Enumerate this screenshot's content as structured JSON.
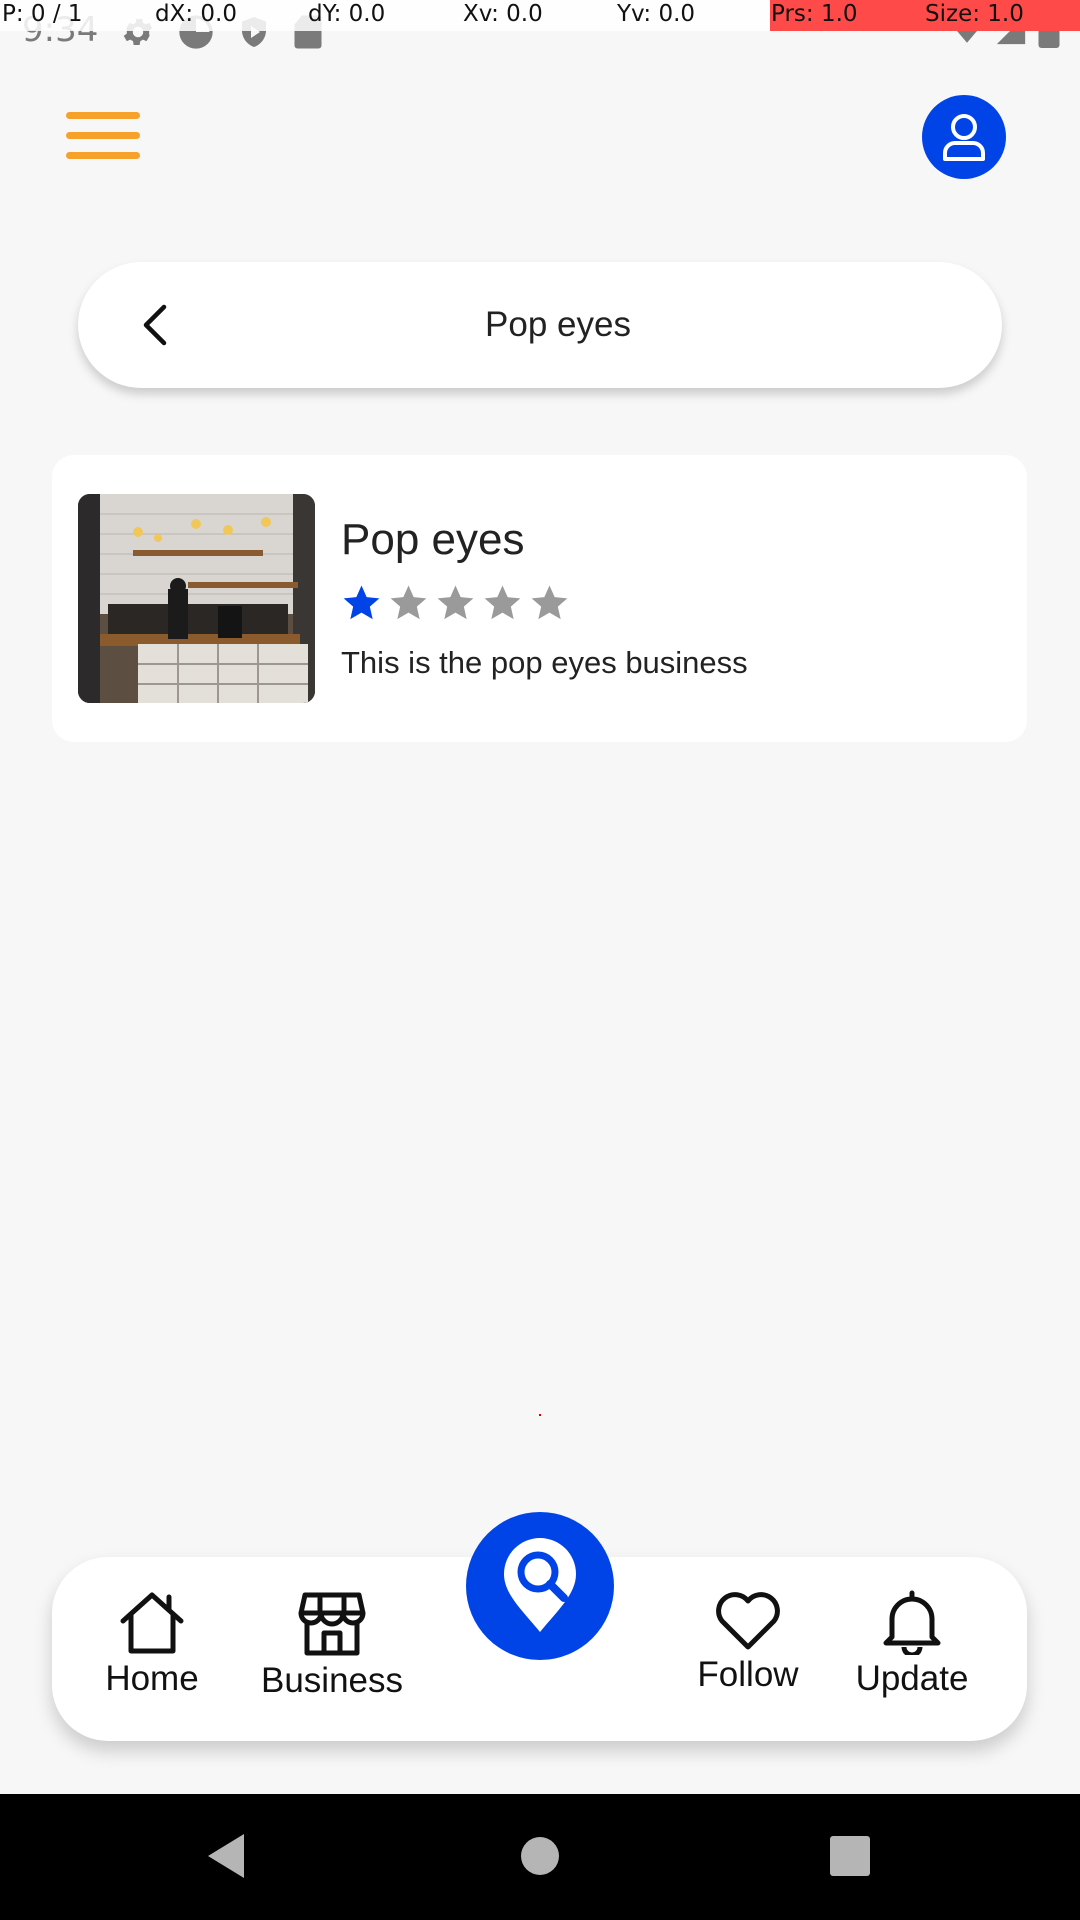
{
  "status_bar": {
    "time": "9:34",
    "overlay": {
      "pointer": "P: 0 / 1",
      "dx": "dX: 0.0",
      "dy": "dY: 0.0",
      "xv": "Xv: 0.0",
      "yv": "Yv: 0.0",
      "pressure": "Prs: 1.0",
      "size": "Size: 1.0"
    }
  },
  "colors": {
    "accent": "#0044e8",
    "menu": "#f5a12a",
    "star_active": "#0044e8",
    "star_inactive": "#9a9a9a",
    "overlay_highlight": "#ff4a4a"
  },
  "header": {
    "menu_icon": "hamburger-menu-icon",
    "profile_icon": "user-profile-icon"
  },
  "search": {
    "value": "Pop eyes",
    "back_icon": "chevron-left-icon"
  },
  "results": [
    {
      "title": "Pop eyes",
      "rating": 1,
      "max_rating": 5,
      "description": "This is the pop eyes business",
      "image": "cafe-interior-photo"
    }
  ],
  "bottom_nav": {
    "items": [
      {
        "label": "Home",
        "icon": "home-icon"
      },
      {
        "label": "Business",
        "icon": "storefront-icon"
      },
      {
        "label": "Follow",
        "icon": "heart-icon"
      },
      {
        "label": "Update",
        "icon": "bell-icon"
      }
    ],
    "fab_icon": "map-pin-search-icon"
  },
  "system_nav": {
    "back": "triangle-back-icon",
    "home": "circle-home-icon",
    "recents": "square-recents-icon"
  }
}
